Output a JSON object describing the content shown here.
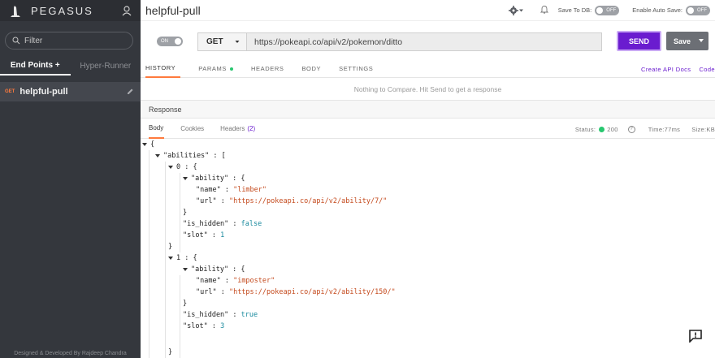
{
  "sidebar": {
    "brand": "PEGASUS",
    "filter_placeholder": "Filter",
    "tabs": {
      "endpoints": "End Points +",
      "hyper_runner": "Hyper-Runner"
    },
    "request": {
      "method": "GET",
      "name": "helpful-pull"
    },
    "footer": "Designed & Developed By Rajdeep Chandra"
  },
  "topbar": {
    "title": "helpful-pull",
    "save_db_label": "Save To DB:",
    "save_db_toggle": "OFF",
    "autosave_label": "Enable Auto Save:",
    "autosave_toggle": "OFF"
  },
  "request": {
    "toggle": "ON",
    "method": "GET",
    "url": "https://pokeapi.co/api/v2/pokemon/ditto",
    "send": "SEND",
    "save": "Save"
  },
  "tabs": {
    "history": "HISTORY",
    "params": "PARAMS",
    "headers": "HEADERS",
    "body": "BODY",
    "settings": "SETTINGS",
    "api_docs": "Create API Docs",
    "code": "Code"
  },
  "compare_message": "Nothing to Compare. Hit Send to get a response",
  "response": {
    "title": "Response",
    "tabs": {
      "body": "Body",
      "cookies": "Cookies",
      "headers": "Headers",
      "headers_count": "(2)"
    },
    "status_label": "Status:",
    "status_code": "200",
    "time": "Time:77ms",
    "size": "Size:KB"
  },
  "json_lines": {
    "l0": "{",
    "l1_key": "\"abilities\"",
    "l1_rest": " : [",
    "l2": "0 : {",
    "l3_key": "\"ability\"",
    "l3_rest": " : {",
    "l4_key": "\"name\"",
    "l4_val": "\"limber\"",
    "l5_key": "\"url\"",
    "l5_val": "\"https://pokeapi.co/api/v2/ability/7/\"",
    "l6": "}",
    "l7_key": "\"is_hidden\"",
    "l7_val": "false",
    "l8_key": "\"slot\"",
    "l8_val": "1",
    "l9": "}",
    "l10": "1 : {",
    "l11_key": "\"ability\"",
    "l11_rest": " : {",
    "l12_key": "\"name\"",
    "l12_val": "\"imposter\"",
    "l13_key": "\"url\"",
    "l13_val": "\"https://pokeapi.co/api/v2/ability/150/\"",
    "l14": "}",
    "l15_key": "\"is_hidden\"",
    "l15_val": "true",
    "l16_key": "\"slot\"",
    "l16_val": "3",
    "l17": "}"
  },
  "colors": {
    "accent": "#6a1ccf",
    "orange": "#ff7a3d",
    "sidebar": "#34373d",
    "status_ok": "#28c76f"
  }
}
